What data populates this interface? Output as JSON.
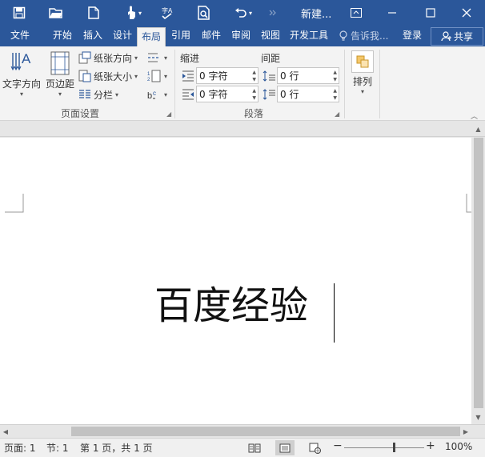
{
  "window": {
    "title": "新建...",
    "colors": {
      "brand": "#2b579a",
      "ribbon": "#f3f3f3"
    }
  },
  "quick_access": [
    {
      "name": "save-icon"
    },
    {
      "name": "open-folder-icon"
    },
    {
      "name": "new-document-icon"
    },
    {
      "name": "touch-mode-icon"
    },
    {
      "name": "spelling-icon"
    },
    {
      "name": "print-preview-icon"
    },
    {
      "name": "undo-icon"
    },
    {
      "name": "redo-icon"
    }
  ],
  "tabs": [
    {
      "id": "file",
      "label": "文件"
    },
    {
      "id": "home",
      "label": "开始"
    },
    {
      "id": "insert",
      "label": "插入"
    },
    {
      "id": "design",
      "label": "设计"
    },
    {
      "id": "layout",
      "label": "布局",
      "active": true
    },
    {
      "id": "references",
      "label": "引用"
    },
    {
      "id": "mailings",
      "label": "邮件"
    },
    {
      "id": "review",
      "label": "审阅"
    },
    {
      "id": "view",
      "label": "视图"
    },
    {
      "id": "developer",
      "label": "开发工具"
    }
  ],
  "tell_me": {
    "label": "告诉我..."
  },
  "login": {
    "label": "登录"
  },
  "share": {
    "label": "共享"
  },
  "ribbon": {
    "page_setup": {
      "label": "页面设置",
      "text_direction": "文字方向",
      "margins": "页边距",
      "orientation": "纸张方向",
      "size": "纸张大小",
      "columns": "分栏"
    },
    "paragraph": {
      "label": "段落",
      "indent_label": "缩进",
      "spacing_label": "间距",
      "indent_left": "0 字符",
      "indent_right": "0 字符",
      "spacing_before": "0 行",
      "spacing_after": "0 行"
    },
    "arrange": {
      "label": "排列"
    }
  },
  "document": {
    "text": "百度经验"
  },
  "status": {
    "page": "页面: 1",
    "section": "节: 1",
    "page_count": "第 1 页，共 1 页",
    "zoom": "100%",
    "zoom_level": 0.62
  }
}
